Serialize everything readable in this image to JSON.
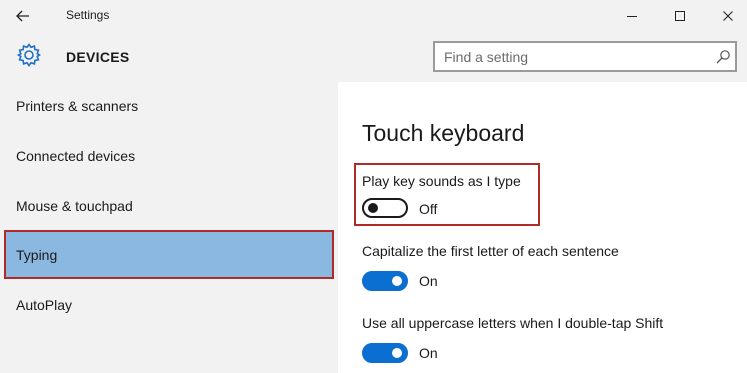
{
  "window": {
    "title": "Settings",
    "minimize_glyph": "—",
    "maximize_glyph": "☐",
    "close_glyph": "✕"
  },
  "header": {
    "section": "DEVICES",
    "section_icon": "gear-icon",
    "accent_color": "#1f6fc5"
  },
  "search": {
    "placeholder": "Find a setting",
    "value": ""
  },
  "sidebar": {
    "items": [
      {
        "label": "Printers & scanners",
        "selected": false
      },
      {
        "label": "Connected devices",
        "selected": false
      },
      {
        "label": "Mouse & touchpad",
        "selected": false
      },
      {
        "label": "Typing",
        "selected": true
      },
      {
        "label": "AutoPlay",
        "selected": false
      }
    ],
    "selected_color": "#8ab8e0",
    "highlight_border_color": "#b02a2a"
  },
  "main": {
    "title": "Touch keyboard",
    "settings": [
      {
        "label": "Play key sounds as I type",
        "state": "Off",
        "on": false,
        "highlighted": true
      },
      {
        "label": "Capitalize the first letter of each sentence",
        "state": "On",
        "on": true,
        "highlighted": false
      },
      {
        "label": "Use all uppercase letters when I double-tap Shift",
        "state": "On",
        "on": true,
        "highlighted": false
      }
    ],
    "toggle_on_color": "#0a6fd0"
  }
}
